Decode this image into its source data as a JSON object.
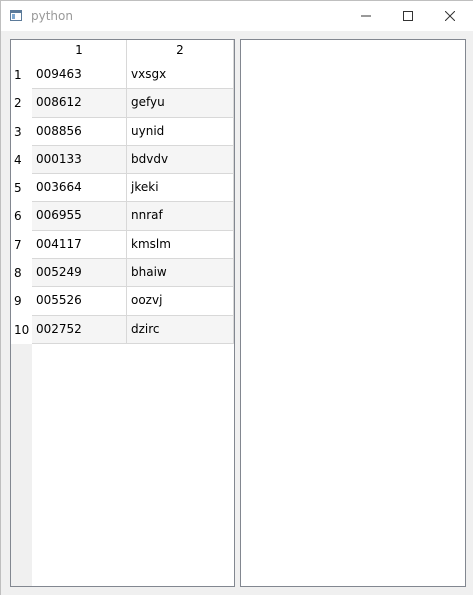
{
  "window": {
    "title": "python",
    "icon": "window-app-icon"
  },
  "title_controls": {
    "minimize_icon": "minimize-icon",
    "maximize_icon": "maximize-icon",
    "close_icon": "close-icon"
  },
  "table": {
    "columns": [
      "1",
      "2"
    ],
    "rows": [
      {
        "num": "1",
        "c1": "009463",
        "c2": "vxsgx"
      },
      {
        "num": "2",
        "c1": "008612",
        "c2": "gefyu"
      },
      {
        "num": "3",
        "c1": "008856",
        "c2": "uynid"
      },
      {
        "num": "4",
        "c1": "000133",
        "c2": "bdvdv"
      },
      {
        "num": "5",
        "c1": "003664",
        "c2": "jkeki"
      },
      {
        "num": "6",
        "c1": "006955",
        "c2": "nnraf"
      },
      {
        "num": "7",
        "c1": "004117",
        "c2": "kmslm"
      },
      {
        "num": "8",
        "c1": "005249",
        "c2": "bhaiw"
      },
      {
        "num": "9",
        "c1": "005526",
        "c2": "oozvj"
      },
      {
        "num": "10",
        "c1": "002752",
        "c2": "dzirc"
      }
    ]
  },
  "colors": {
    "alternate_row": "#f5f5f5",
    "pane_border": "#828790",
    "title_text": "#999999"
  }
}
